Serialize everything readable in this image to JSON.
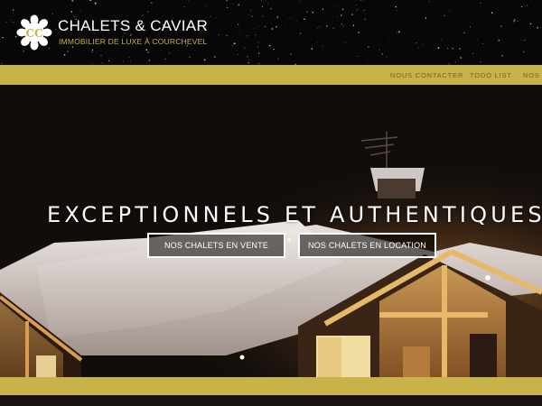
{
  "header": {
    "brand_title": "CHALETS & CAVIAR",
    "brand_tagline": "IMMOBILIER DE LUXE À COURCHEVEL",
    "logo_icon": "snowflake-cc-logo-icon"
  },
  "nav": {
    "items": [
      {
        "label": "NOUS CONTACTER"
      },
      {
        "label": "TODO LIST"
      },
      {
        "label": "NOS V"
      }
    ]
  },
  "hero": {
    "headline": "EXCEPTIONNELS ET AUTHENTIQUES.",
    "cta_sale": "NOS CHALETS EN VENTE",
    "cta_rent": "NOS CHALETS EN LOCATION"
  },
  "colors": {
    "gold": "#c8b34b",
    "header_bg": "#070708",
    "hero_bg": "#120e0c",
    "white": "#ffffff"
  }
}
